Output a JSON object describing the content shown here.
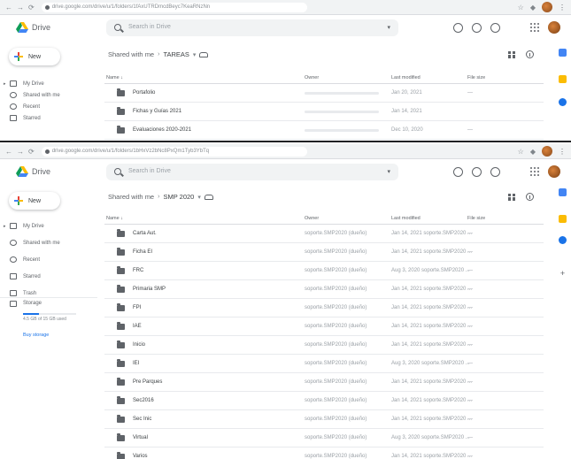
{
  "browser": {
    "nav": [
      "←",
      "→",
      "⟳"
    ],
    "top_url": "drive.google.com/drive/u/1/folders/1fAxUTRDmcdBeyc7KeaRNzNn",
    "bottom_url": "drive.google.com/drive/u/1/folders/1bHxVz2bNc8PxQm1Tyb3YbTq"
  },
  "drive": {
    "app_name": "Drive",
    "search_placeholder": "Search in Drive",
    "new_label": "New"
  },
  "top_panel": {
    "breadcrumb_root": "Shared with me",
    "breadcrumb_current": "TAREAS",
    "sidebar": [
      {
        "label": "My Drive"
      },
      {
        "label": "Shared with me"
      },
      {
        "label": "Recent"
      },
      {
        "label": "Starred"
      }
    ],
    "columns": {
      "name": "Name ↓",
      "owner": "Owner",
      "modified": "Last modified",
      "size": "File size"
    },
    "rows": [
      {
        "name": "Portafolio",
        "modified": "Jan 20, 2021",
        "size": "—"
      },
      {
        "name": "Fichas y Guías 2021",
        "modified": "Jan 14, 2021",
        "size": ""
      },
      {
        "name": "Evaluaciones 2020-2021",
        "modified": "Dec 10, 2020",
        "size": "—"
      }
    ]
  },
  "bottom_panel": {
    "breadcrumb_root": "Shared with me",
    "breadcrumb_current": "SMP 2020",
    "sidebar": [
      {
        "label": "My Drive"
      },
      {
        "label": "Shared with me"
      },
      {
        "label": "Recent"
      },
      {
        "label": "Starred"
      },
      {
        "label": "Trash"
      }
    ],
    "storage": {
      "label": "Storage",
      "used_text": "4.5 GB of 15 GB used",
      "fill": 0.3,
      "buy": "Buy storage"
    },
    "columns": {
      "name": "Name ↓",
      "owner": "Owner",
      "modified": "Last modified",
      "size": "File size"
    },
    "rows": [
      {
        "name": "Carta Aut.",
        "owner": "soporte.SMP2020 (dueño)",
        "modified": "Jan 14, 2021 soporte.SMP2020 ...",
        "size": "—"
      },
      {
        "name": "Ficha EI",
        "owner": "soporte.SMP2020 (dueño)",
        "modified": "Jan 14, 2021 soporte.SMP2020 ...",
        "size": "—"
      },
      {
        "name": "FRC",
        "owner": "soporte.SMP2020 (dueño)",
        "modified": "Aug 3, 2020 soporte.SMP2020 ...",
        "size": "—"
      },
      {
        "name": "Primaria SMP",
        "owner": "soporte.SMP2020 (dueño)",
        "modified": "Jan 14, 2021 soporte.SMP2020 ...",
        "size": "—"
      },
      {
        "name": "FPI",
        "owner": "soporte.SMP2020 (dueño)",
        "modified": "Jan 14, 2021 soporte.SMP2020 ...",
        "size": "—"
      },
      {
        "name": "IAE",
        "owner": "soporte.SMP2020 (dueño)",
        "modified": "Jan 14, 2021 soporte.SMP2020 ...",
        "size": "—"
      },
      {
        "name": "Inicio",
        "owner": "soporte.SMP2020 (dueño)",
        "modified": "Jan 14, 2021 soporte.SMP2020 ...",
        "size": "—"
      },
      {
        "name": "IEI",
        "owner": "soporte.SMP2020 (dueño)",
        "modified": "Aug 3, 2020 soporte.SMP2020 ...",
        "size": "—"
      },
      {
        "name": "Pre Parques",
        "owner": "soporte.SMP2020 (dueño)",
        "modified": "Jan 14, 2021 soporte.SMP2020 ...",
        "size": "—"
      },
      {
        "name": "Sec2016",
        "owner": "soporte.SMP2020 (dueño)",
        "modified": "Jan 14, 2021 soporte.SMP2020 ...",
        "size": "—"
      },
      {
        "name": "Sec Inic",
        "owner": "soporte.SMP2020 (dueño)",
        "modified": "Jan 14, 2021 soporte.SMP2020 ...",
        "size": "—"
      },
      {
        "name": "Virtual",
        "owner": "soporte.SMP2020 (dueño)",
        "modified": "Aug 3, 2020 soporte.SMP2020 ...",
        "size": "—"
      },
      {
        "name": "Varios",
        "owner": "soporte.SMP2020 (dueño)",
        "modified": "Jan 14, 2021 soporte.SMP2020 ...",
        "size": "—"
      }
    ]
  },
  "colors": {
    "accent": "#1a73e8",
    "text": "#3c4043",
    "muted": "#5f6368"
  },
  "icons": [
    "drive-logo-icon",
    "search-icon",
    "help-icon",
    "settings-icon",
    "apps-icon",
    "grid-view-icon",
    "info-icon",
    "folder-icon",
    "people-icon",
    "calendar-icon",
    "keep-icon",
    "tasks-icon",
    "add-icon"
  ]
}
